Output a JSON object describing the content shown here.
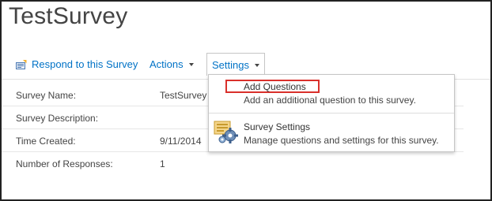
{
  "page": {
    "title": "TestSurvey"
  },
  "toolbar": {
    "respond_label": "Respond to this Survey",
    "actions_label": "Actions",
    "settings_label": "Settings"
  },
  "properties": [
    {
      "label": "Survey Name:",
      "value": "TestSurvey"
    },
    {
      "label": "Survey Description:",
      "value": ""
    },
    {
      "label": "Time Created:",
      "value": "9/11/2014"
    },
    {
      "label": "Number of Responses:",
      "value": "1"
    }
  ],
  "settings_menu": {
    "items": [
      {
        "title": "Add Questions",
        "description": "Add an additional question to this survey."
      },
      {
        "title": "Survey Settings",
        "description": "Manage questions and settings for this survey."
      }
    ]
  },
  "colors": {
    "link": "#0072c6",
    "highlight": "#d9302b",
    "text": "#444444"
  },
  "icons": {
    "respond": "survey-respond-icon",
    "survey_settings": "gear-settings-icon"
  }
}
